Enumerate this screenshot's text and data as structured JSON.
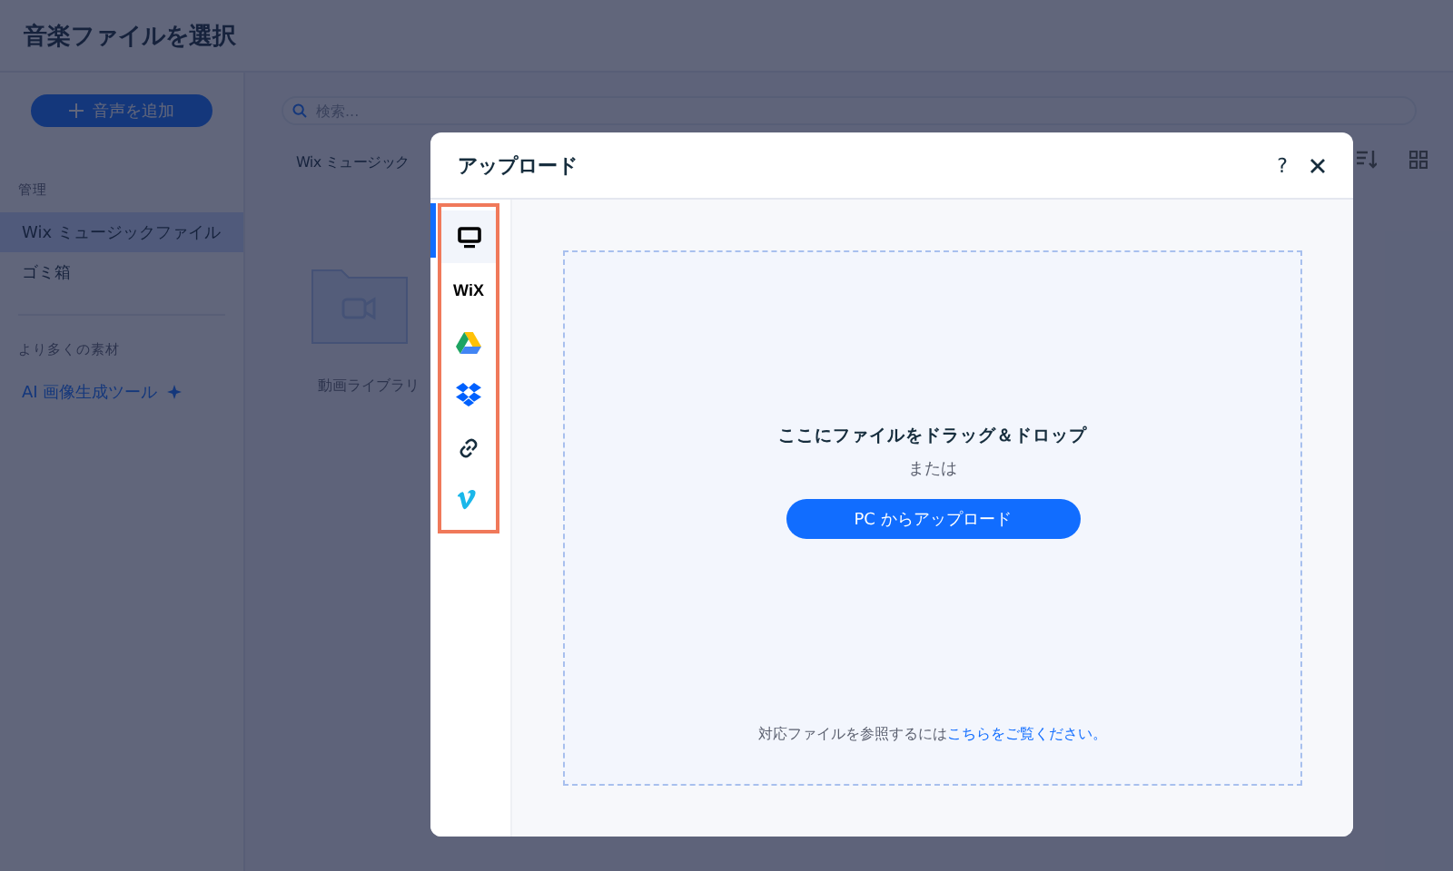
{
  "page": {
    "title": "音楽ファイルを選択"
  },
  "sidebar": {
    "add_button": "音声を追加",
    "sections": [
      {
        "label": "管理",
        "items": [
          {
            "label": "Wix ミュージックファイル",
            "selected": true,
            "kind": "plain"
          },
          {
            "label": "ゴミ箱",
            "selected": false,
            "kind": "plain"
          }
        ]
      },
      {
        "label": "より多くの素材",
        "items": [
          {
            "label": "AI 画像生成ツール",
            "selected": false,
            "kind": "link"
          }
        ]
      }
    ]
  },
  "main": {
    "search": {
      "placeholder": "検索..."
    },
    "breadcrumb": "Wix ミュージック",
    "folders": [
      {
        "label": "動画ライブラリ"
      }
    ]
  },
  "dialog": {
    "title": "アップロード",
    "help": "?",
    "sources": [
      {
        "kind": "computer",
        "selected": true
      },
      {
        "kind": "wix",
        "label": "WiX",
        "selected": false
      },
      {
        "kind": "drive",
        "selected": false
      },
      {
        "kind": "dropbox",
        "selected": false
      },
      {
        "kind": "link",
        "selected": false
      },
      {
        "kind": "vimeo",
        "selected": false
      }
    ],
    "dropzone": {
      "heading": "ここにファイルをドラッグ＆ドロップ",
      "or": "または",
      "button": "PC からアップロード",
      "note": "対応ファイルを参照するには",
      "note_link": "こちらをご覧ください。"
    }
  }
}
